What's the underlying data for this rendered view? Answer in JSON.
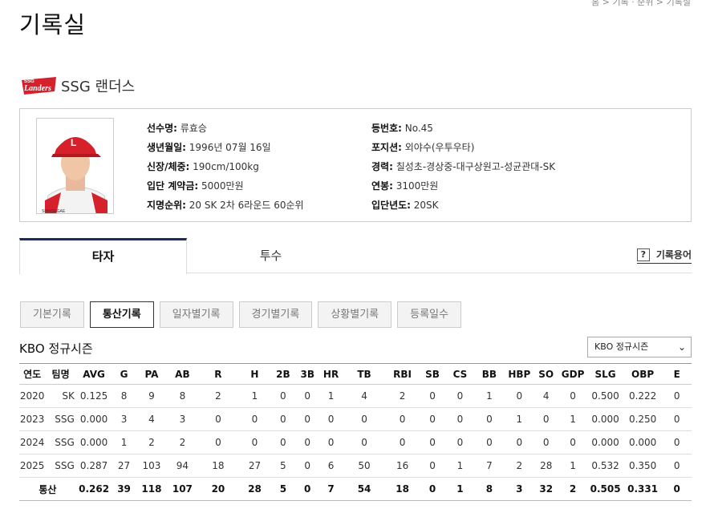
{
  "breadcrumb": "홈 > 기록 · 순위 > 기록실",
  "page_title": "기록실",
  "team": {
    "logo_text": "Landers",
    "logo_small": "SSG",
    "name": "SSG 랜더스"
  },
  "player": {
    "photo_caption": "SHINSEGAE",
    "left": [
      {
        "label": "선수명:",
        "value": " 류효승"
      },
      {
        "label": "생년월일:",
        "value": " 1996년 07월 16일"
      },
      {
        "label": "신장/체중:",
        "value": " 190cm/100kg"
      },
      {
        "label": "입단 계약금:",
        "value": " 5000만원"
      },
      {
        "label": "지명순위:",
        "value": " 20 SK 2차 6라운드 60순위"
      }
    ],
    "right": [
      {
        "label": "등번호:",
        "value": " No.45"
      },
      {
        "label": "포지션:",
        "value": " 외야수(우투우타)"
      },
      {
        "label": "경력:",
        "value": " 칠성초-경상중-대구상원고-성균관대-SK"
      },
      {
        "label": "연봉:",
        "value": " 3100만원"
      },
      {
        "label": "입단년도:",
        "value": " 20SK"
      }
    ]
  },
  "tabs": {
    "hitter": "타자",
    "pitcher": "투수",
    "glossary_icon": "?",
    "glossary": "기록용어"
  },
  "subtabs": [
    "기본기록",
    "통산기록",
    "일자별기록",
    "경기별기록",
    "상황별기록",
    "등록일수"
  ],
  "section_title": "KBO 정규시즌",
  "season_select": "KBO 정규시즌",
  "table": {
    "headers": [
      "연도",
      "팀명",
      "AVG",
      "G",
      "PA",
      "AB",
      "R",
      "H",
      "2B",
      "3B",
      "HR",
      "TB",
      "RBI",
      "SB",
      "CS",
      "BB",
      "HBP",
      "SO",
      "GDP",
      "SLG",
      "OBP",
      "E"
    ],
    "rows": [
      [
        "2020",
        "SK",
        "0.125",
        "8",
        "9",
        "8",
        "2",
        "1",
        "0",
        "0",
        "1",
        "4",
        "2",
        "0",
        "0",
        "1",
        "0",
        "4",
        "0",
        "0.500",
        "0.222",
        "0"
      ],
      [
        "2023",
        "SSG",
        "0.000",
        "3",
        "4",
        "3",
        "0",
        "0",
        "0",
        "0",
        "0",
        "0",
        "0",
        "0",
        "0",
        "0",
        "1",
        "0",
        "1",
        "0.000",
        "0.250",
        "0"
      ],
      [
        "2024",
        "SSG",
        "0.000",
        "1",
        "2",
        "2",
        "0",
        "0",
        "0",
        "0",
        "0",
        "0",
        "0",
        "0",
        "0",
        "0",
        "0",
        "0",
        "0",
        "0.000",
        "0.000",
        "0"
      ],
      [
        "2025",
        "SSG",
        "0.287",
        "27",
        "103",
        "94",
        "18",
        "27",
        "5",
        "0",
        "6",
        "50",
        "16",
        "0",
        "1",
        "7",
        "2",
        "28",
        "1",
        "0.532",
        "0.350",
        "0"
      ]
    ],
    "total": [
      "통산",
      "0.262",
      "39",
      "118",
      "107",
      "20",
      "28",
      "5",
      "0",
      "7",
      "54",
      "18",
      "0",
      "1",
      "8",
      "3",
      "32",
      "2",
      "0.505",
      "0.331",
      "0"
    ]
  },
  "colors": {
    "tab_accent": "#1b2b5b",
    "logo_red": "#d6202b"
  }
}
